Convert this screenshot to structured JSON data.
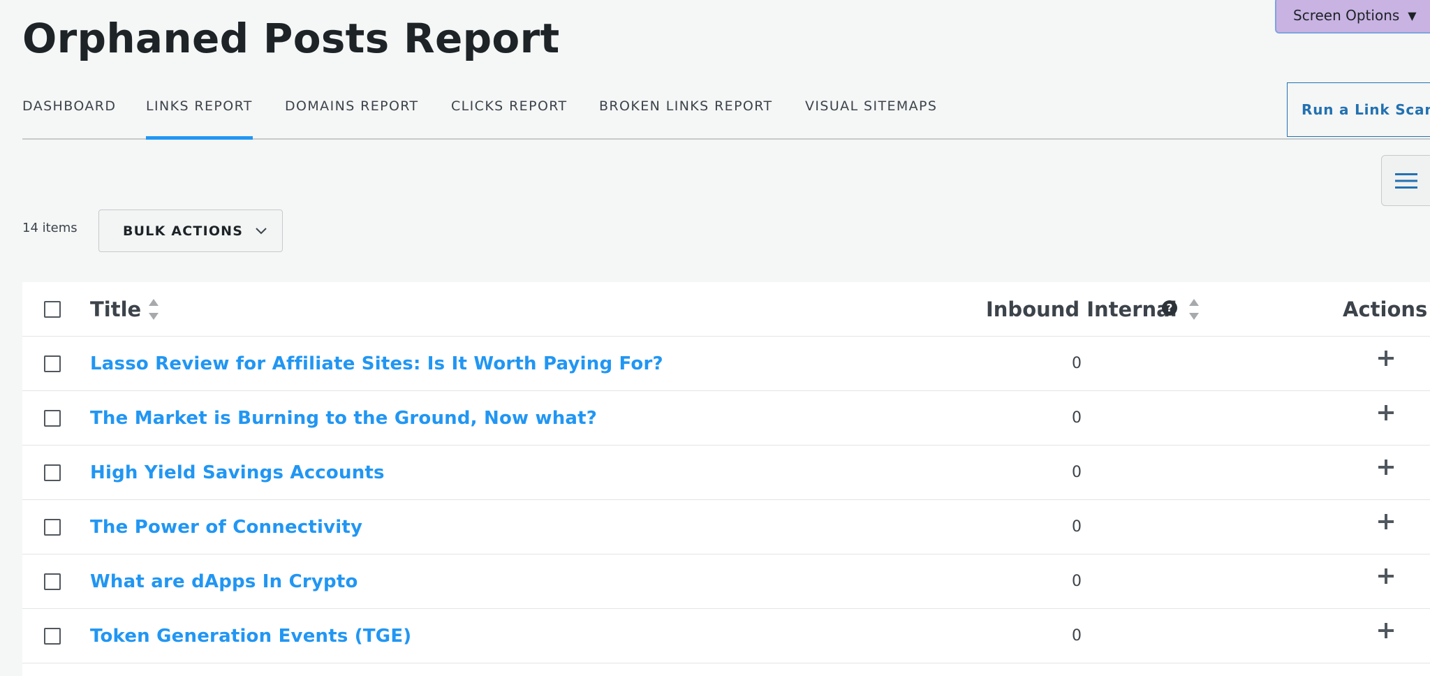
{
  "page_title": "Orphaned Posts Report",
  "screen_options": {
    "label": "Screen Options",
    "caret": "▼"
  },
  "tabs": [
    {
      "label": "DASHBOARD",
      "active": false
    },
    {
      "label": "LINKS REPORT",
      "active": true
    },
    {
      "label": "DOMAINS REPORT",
      "active": false
    },
    {
      "label": "CLICKS REPORT",
      "active": false
    },
    {
      "label": "BROKEN LINKS REPORT",
      "active": false
    },
    {
      "label": "VISUAL SITEMAPS",
      "active": false
    }
  ],
  "run_scan_label": "Run a Link Scan",
  "menu_icon": "hamburger-menu-icon",
  "items_count": "14 items",
  "bulk_actions_label": "BULK ACTIONS",
  "table": {
    "columns": {
      "title": "Title",
      "inbound": "Inbound Internal",
      "actions": "Actions"
    },
    "help_glyph": "?",
    "rows": [
      {
        "title": "Lasso Review for Affiliate Sites: Is It Worth Paying For?",
        "inbound": "0"
      },
      {
        "title": "The Market is Burning to the Ground, Now what?",
        "inbound": "0"
      },
      {
        "title": "High Yield Savings Accounts",
        "inbound": "0"
      },
      {
        "title": "The Power of Connectivity",
        "inbound": "0"
      },
      {
        "title": "What are dApps In Crypto",
        "inbound": "0"
      },
      {
        "title": "Token Generation Events (TGE)",
        "inbound": "0"
      }
    ]
  },
  "colors": {
    "accent": "#2196f3",
    "link_button": "#2271b1",
    "screen_options_bg": "#c9b3e3",
    "background": "#f5f6f6"
  }
}
